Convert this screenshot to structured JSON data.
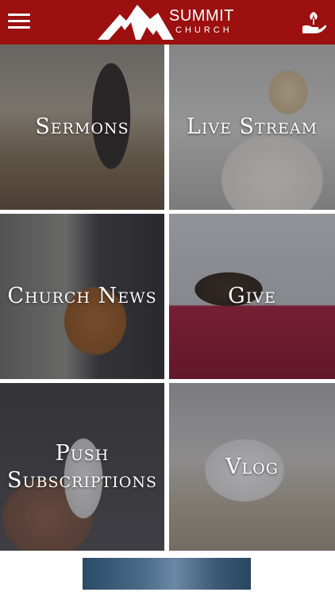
{
  "header": {
    "brand_name": "SUMMIT",
    "brand_sub": "CHURCH",
    "menu_icon": "hamburger-menu-icon",
    "right_icon": "hand-with-plant-icon",
    "background": "#9c1010"
  },
  "tiles": [
    {
      "label": "Sermons"
    },
    {
      "label": "Live Stream"
    },
    {
      "label": "Church News"
    },
    {
      "label": "Give"
    },
    {
      "label": "Push\nSubscriptions"
    },
    {
      "label": "Vlog"
    }
  ]
}
